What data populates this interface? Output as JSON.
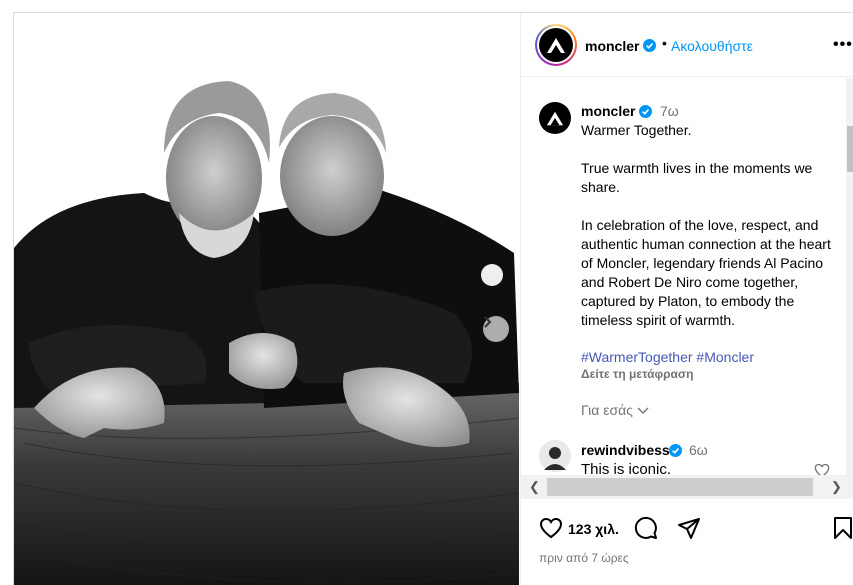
{
  "header": {
    "username": "moncler",
    "separator": "•",
    "follow_label": "Ακολουθήστε",
    "more_label": "•••"
  },
  "caption": {
    "username": "moncler",
    "time": "7ω",
    "text": "Warmer Together.\n\nTrue warmth lives in the moments we share.\n\nIn celebration of the love, respect, and authentic human connection at the heart of Moncler, legendary friends Al Pacino and Robert De Niro come together, captured by Platon, to embody the timeless spirit of warmth.",
    "hashtags": [
      "#WarmerTogether",
      "#Moncler"
    ],
    "translate_label": "Δείτε τη μετάφραση",
    "for_you_label": "Για εσάς"
  },
  "comment": {
    "username": "rewindvibess",
    "time": "6ω",
    "text": "This is iconic."
  },
  "actions": {
    "likes": "123 χιλ.",
    "posted": "πριν από 7 ώρες"
  },
  "scrollbar": {
    "left_arrow": "❮",
    "right_arrow": "❯"
  },
  "icons": {
    "verified": "verified-badge-icon",
    "like": "heart-icon",
    "comment": "comment-bubble-icon",
    "share": "paper-plane-icon",
    "save": "bookmark-icon",
    "next": "chevron-right-icon"
  },
  "colors": {
    "link_blue": "#0095f6",
    "hashtag": "#4658b7",
    "muted": "#737373",
    "verified": "#0095f6"
  }
}
